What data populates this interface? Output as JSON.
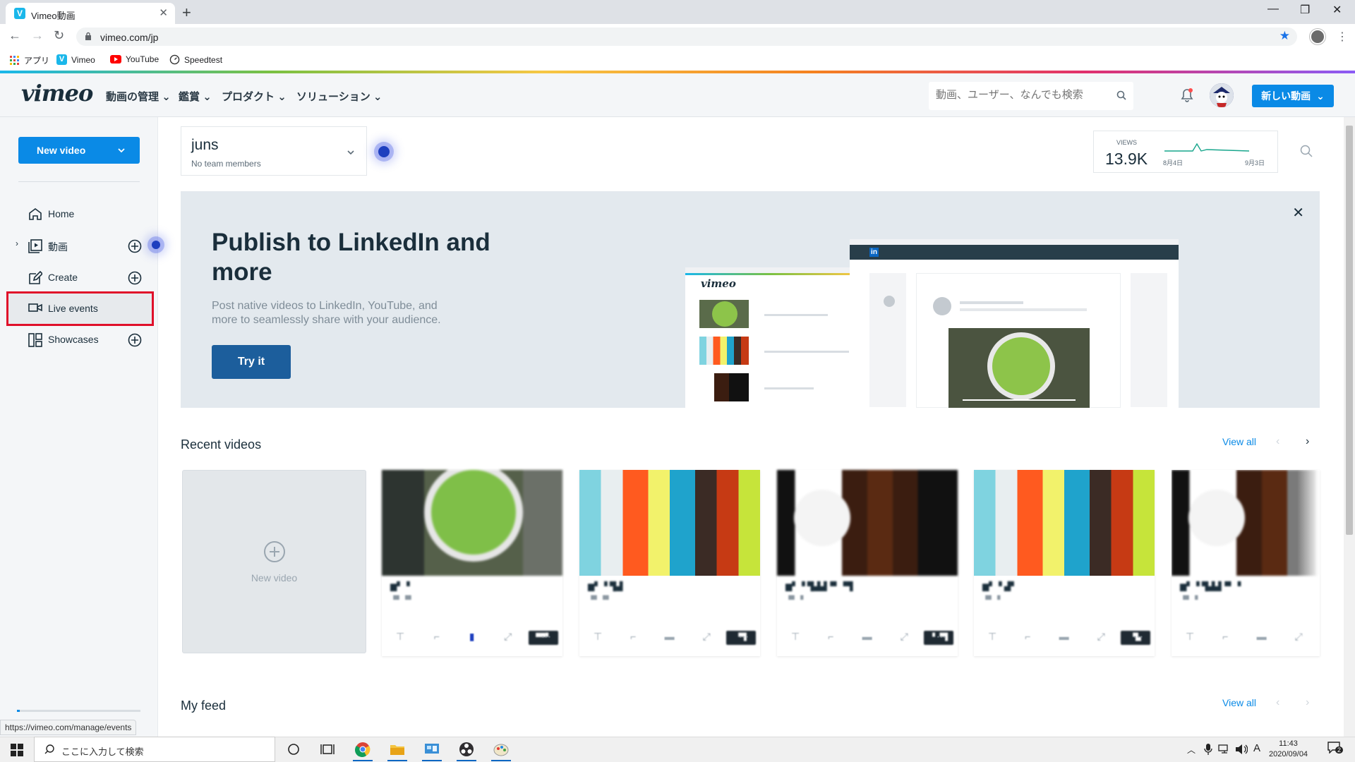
{
  "browser": {
    "tab_title": "Vimeo動画",
    "tab_favicon": "V",
    "url": "vimeo.com/jp",
    "bookmarks": [
      {
        "label": "アプリ",
        "icon": "apps-grid-icon"
      },
      {
        "label": "Vimeo",
        "icon": "vimeo-icon"
      },
      {
        "label": "YouTube",
        "icon": "youtube-icon"
      },
      {
        "label": "Speedtest",
        "icon": "speedtest-icon"
      }
    ],
    "status_url": "https://vimeo.com/manage/events"
  },
  "header": {
    "logo": "vimeo",
    "menu": [
      {
        "label": "動画の管理"
      },
      {
        "label": "鑑賞"
      },
      {
        "label": "プロダクト"
      },
      {
        "label": "ソリューション"
      }
    ],
    "search_placeholder": "動画、ユーザー、なんでも検索",
    "new_button": "新しい動画",
    "accent": "#0a8ae6"
  },
  "sidebar": {
    "new_video": "New video",
    "items": [
      {
        "label": "Home",
        "icon": "home-icon"
      },
      {
        "label": "動画",
        "icon": "video-library-icon"
      },
      {
        "label": "Create",
        "icon": "create-icon"
      },
      {
        "label": "Live events",
        "icon": "camera-icon"
      },
      {
        "label": "Showcases",
        "icon": "showcase-icon"
      }
    ]
  },
  "team": {
    "name": "juns",
    "members": "No team members"
  },
  "stats": {
    "label": "VIEWS",
    "value": "13.9K",
    "start": "8月4日",
    "end": "9月3日"
  },
  "banner": {
    "heading": "Publish to LinkedIn and more",
    "body": "Post native videos to LinkedIn, YouTube, and more to seamlessly share with your audience.",
    "cta": "Try it",
    "mock_logo": "vimeo",
    "mock_social": "in"
  },
  "recent": {
    "title": "Recent videos",
    "view_all": "View all",
    "new_video": "New video",
    "videos": [
      {
        "title": "▆▘▝",
        "sub": "▝▘▝▘",
        "duration": "▀▀▘"
      },
      {
        "title": "▆▘▝ ▜▟",
        "sub": "▝▘▝▘",
        "duration": "▝▜"
      },
      {
        "title": "▆▘▝ ▜▟▟▝▘▝▜",
        "sub": "▝▘▝",
        "duration": "▝ ▝▜"
      },
      {
        "title": "▆▘▝ ▟▘",
        "sub": "▝▘▝",
        "duration": "▝▙"
      },
      {
        "title": "▆▘▝ ▜▟▟▝▘▝",
        "sub": "▝▘▝",
        "duration": ""
      }
    ]
  },
  "feed": {
    "title": "My feed",
    "view_all": "View all"
  },
  "taskbar": {
    "search_placeholder": "ここに入力して検索",
    "time": "11:43",
    "date": "2020/09/04",
    "ime": "A",
    "notifications": "2"
  }
}
